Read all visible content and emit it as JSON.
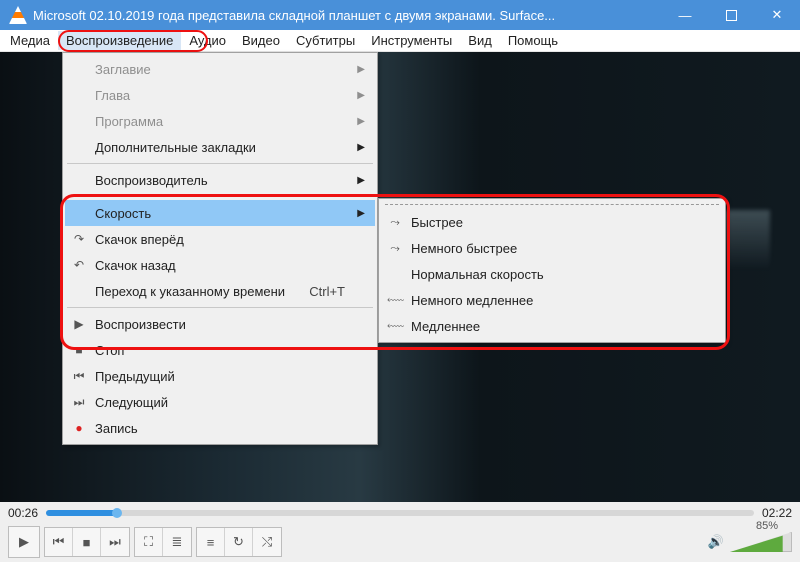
{
  "window": {
    "title": "Microsoft 02.10.2019 года представила складной планшет с двумя экранами. Surface..."
  },
  "menubar": [
    "Медиа",
    "Воспроизведение",
    "Аудио",
    "Видео",
    "Субтитры",
    "Инструменты",
    "Вид",
    "Помощь"
  ],
  "playback_menu": {
    "items": [
      {
        "label": "Заглавие",
        "disabled": true,
        "submenu": true
      },
      {
        "label": "Глава",
        "disabled": true,
        "submenu": true
      },
      {
        "label": "Программа",
        "disabled": true,
        "submenu": true
      },
      {
        "label": "Дополнительные закладки",
        "submenu": true
      },
      {
        "label": "Воспроизводитель",
        "submenu": true,
        "sep": "before"
      },
      {
        "label": "Скорость",
        "submenu": true,
        "highlight": true,
        "sep": "before"
      },
      {
        "label": "Скачок вперёд",
        "icon": "jump-forward"
      },
      {
        "label": "Скачок назад",
        "icon": "jump-back"
      },
      {
        "label": "Переход к указанному времени",
        "shortcut": "Ctrl+T"
      },
      {
        "label": "Воспроизвести",
        "icon": "play",
        "sep": "before"
      },
      {
        "label": "Стоп",
        "icon": "stop"
      },
      {
        "label": "Предыдущий",
        "icon": "prev"
      },
      {
        "label": "Следующий",
        "icon": "next"
      },
      {
        "label": "Запись",
        "icon": "record"
      }
    ]
  },
  "speed_submenu": {
    "items": [
      {
        "label": "Быстрее",
        "icon": "faster"
      },
      {
        "label": "Немного быстрее",
        "icon": "slightly-faster"
      },
      {
        "label": "Нормальная скорость"
      },
      {
        "label": "Немного медленнее",
        "icon": "slightly-slower"
      },
      {
        "label": "Медленнее",
        "icon": "slower"
      }
    ]
  },
  "playback": {
    "current_time": "00:26",
    "total_time": "02:22",
    "progress_pct": 10,
    "volume_pct": "85%",
    "volume_fill": 85
  },
  "icons": {
    "minimize": "—",
    "maximize": "◻",
    "close": "✕",
    "play": "▶",
    "stop": "■",
    "prev": "⏮",
    "next": "⏭",
    "jump-forward": "↷",
    "jump-back": "↶",
    "record": "●",
    "fullscreen": "⛶",
    "ext": "≣",
    "playlist": "≡",
    "loop": "↻",
    "shuffle": "⤭",
    "speaker": "🔊",
    "faster": "⤳",
    "slightly-faster": "⤳",
    "slightly-slower": "⬳",
    "slower": "⬳"
  }
}
